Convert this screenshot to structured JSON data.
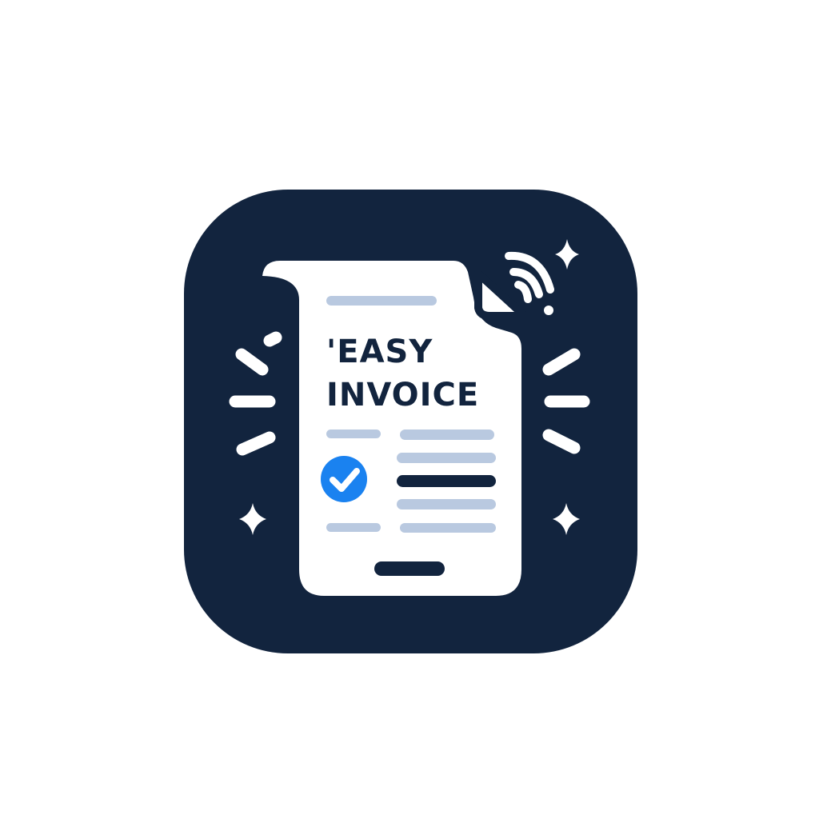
{
  "logo": {
    "title_line_1": "'EASY",
    "title_line_2": "INVOICE"
  },
  "icons": [
    "invoice-document-icon",
    "signal-waves-icon",
    "checkmark-badge-icon",
    "sparkle-icon",
    "burst-lines-icon"
  ],
  "colors": {
    "background": "#ffffff",
    "tile": "#12243e",
    "paper": "#ffffff",
    "line_light": "#b9c9e0",
    "line_dark": "#12243e",
    "check_badge": "#1a82f0"
  }
}
